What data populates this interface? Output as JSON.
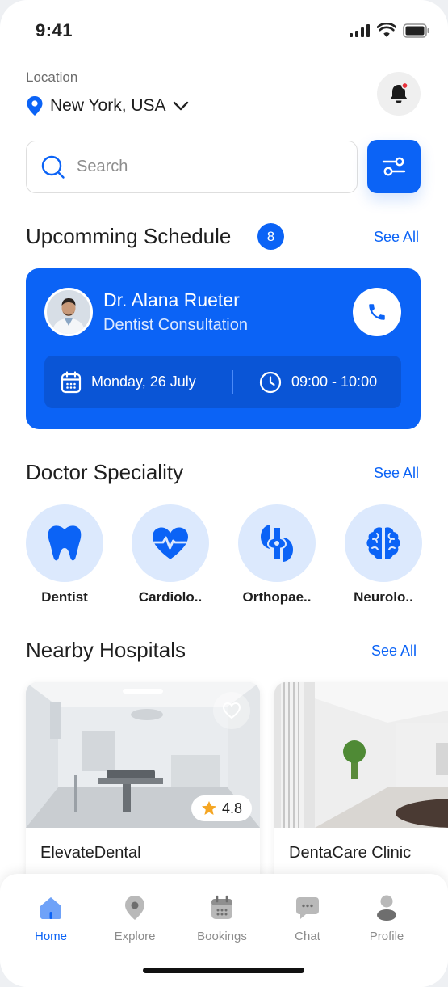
{
  "status_bar": {
    "time": "9:41"
  },
  "location": {
    "label": "Location",
    "value": "New York, USA"
  },
  "search": {
    "placeholder": "Search"
  },
  "schedule": {
    "title": "Upcomming Schedule",
    "count": "8",
    "see_all": "See All",
    "card": {
      "doctor_name": "Dr. Alana Rueter",
      "specialty": "Dentist Consultation",
      "date": "Monday, 26 July",
      "time": "09:00 - 10:00"
    }
  },
  "speciality": {
    "title": "Doctor Speciality",
    "see_all": "See All",
    "items": [
      {
        "label": "Dentist",
        "icon": "tooth-icon"
      },
      {
        "label": "Cardiolo..",
        "icon": "heart-pulse-icon"
      },
      {
        "label": "Orthopae..",
        "icon": "bone-joint-icon"
      },
      {
        "label": "Neurolo..",
        "icon": "brain-icon"
      }
    ]
  },
  "hospitals": {
    "title": "Nearby Hospitals",
    "see_all": "See All",
    "items": [
      {
        "name": "ElevateDental",
        "rating": "4.8"
      },
      {
        "name": "DentaCare Clinic"
      }
    ]
  },
  "nav": {
    "items": [
      {
        "label": "Home",
        "icon": "home-icon",
        "active": true
      },
      {
        "label": "Explore",
        "icon": "location-pin-icon"
      },
      {
        "label": "Bookings",
        "icon": "calendar-icon"
      },
      {
        "label": "Chat",
        "icon": "chat-icon"
      },
      {
        "label": "Profile",
        "icon": "profile-icon"
      }
    ]
  },
  "colors": {
    "accent": "#0b63f6",
    "accent_light": "#dce9fd",
    "rating_star": "#f5a623"
  }
}
